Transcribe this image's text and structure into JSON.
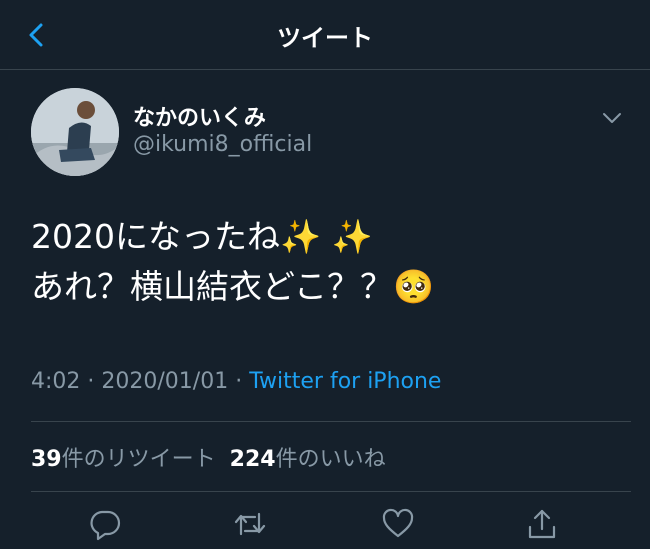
{
  "header": {
    "title": "ツイート",
    "accent": "#1da1f2"
  },
  "tweet": {
    "display_name": "なかのいくみ",
    "handle": "@ikumi8_official",
    "lines": [
      "2020になったね✨ ✨",
      "あれ？横山結衣どこ？？🥺"
    ],
    "time": "4:02",
    "date": "2020/01/01",
    "separator": "·",
    "via": "Twitter for iPhone",
    "retweet_count": "39",
    "retweet_label": "件のリツイート",
    "like_count": "224",
    "like_label": "件のいいね"
  },
  "actions": [
    "reply-icon",
    "retweet-icon",
    "like-icon",
    "share-icon"
  ]
}
